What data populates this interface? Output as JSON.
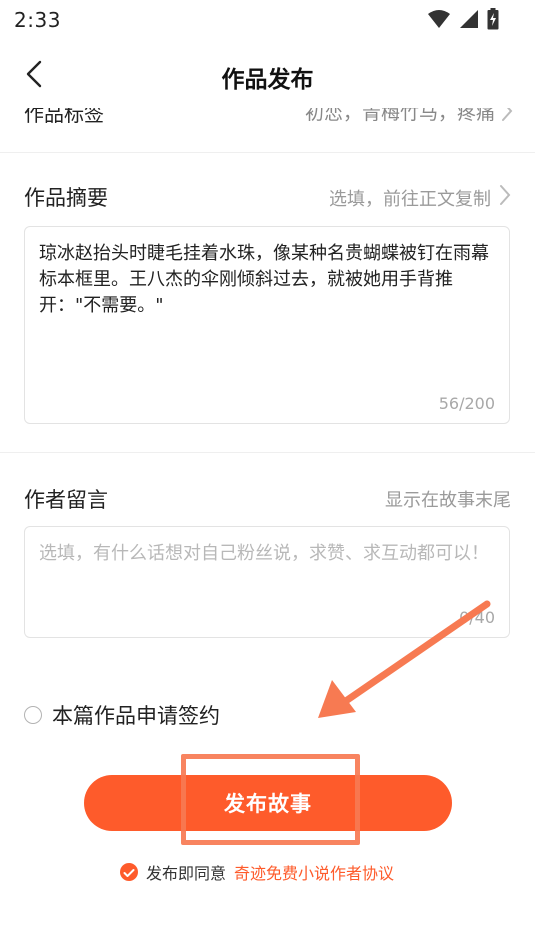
{
  "status_bar": {
    "time": "2:33"
  },
  "header": {
    "title": "作品发布"
  },
  "tags_row": {
    "label": "作品标签",
    "value": "初恋，青梅竹马，疼痛"
  },
  "summary": {
    "title": "作品摘要",
    "hint": "选填，前往正文复制",
    "text": "琼冰赵抬头时睫毛挂着水珠，像某种名贵蝴蝶被钉在雨幕标本框里。王八杰的伞刚倾斜过去，就被她用手背推开：\"不需要。\"",
    "counter": "56/200"
  },
  "author_note": {
    "title": "作者留言",
    "hint": "显示在故事末尾",
    "placeholder": "选填，有什么话想对自己粉丝说，求赞、求互动都可以！",
    "counter": "0/40"
  },
  "sign": {
    "label": "本篇作品申请签约"
  },
  "publish": {
    "label": "发布故事"
  },
  "agreement": {
    "prefix": "发布即同意",
    "link": "奇迹免费小说作者协议"
  },
  "colors": {
    "accent": "#fe5b2b",
    "annotation": "#f77a52"
  }
}
